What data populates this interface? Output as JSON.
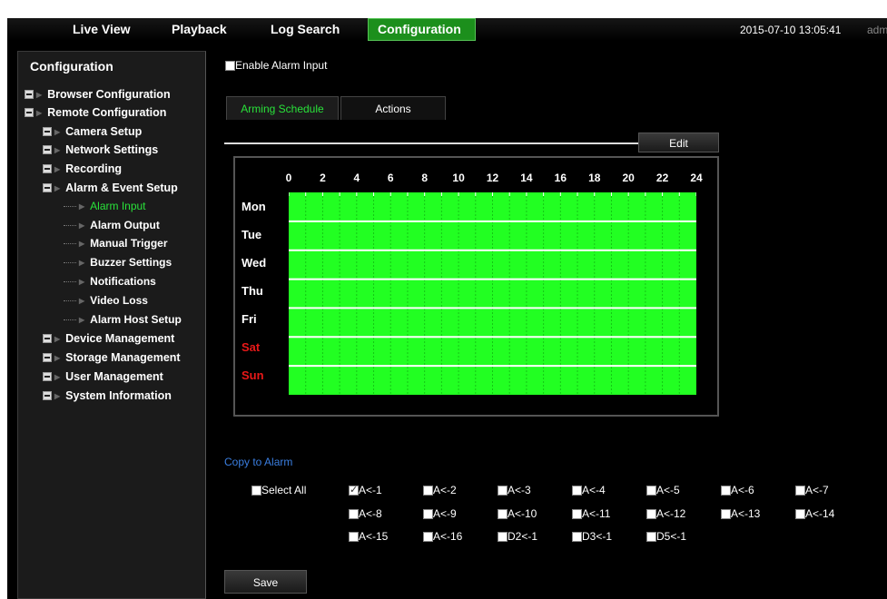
{
  "nav": {
    "tabs": [
      {
        "label": "Live View"
      },
      {
        "label": "Playback"
      },
      {
        "label": "Log Search"
      },
      {
        "label": "Configuration"
      }
    ],
    "datetime": "2015-07-10 13:05:41",
    "user": "adm"
  },
  "sidebar": {
    "title": "Configuration",
    "items": [
      {
        "label": "Browser Configuration"
      },
      {
        "label": "Remote Configuration"
      },
      {
        "label": "Camera Setup"
      },
      {
        "label": "Network Settings"
      },
      {
        "label": "Recording"
      },
      {
        "label": "Alarm & Event Setup"
      },
      {
        "label": "Alarm Input"
      },
      {
        "label": "Alarm Output"
      },
      {
        "label": "Manual Trigger"
      },
      {
        "label": "Buzzer Settings"
      },
      {
        "label": "Notifications"
      },
      {
        "label": "Video Loss"
      },
      {
        "label": "Alarm Host Setup"
      },
      {
        "label": "Device Management"
      },
      {
        "label": "Storage Management"
      },
      {
        "label": "User Management"
      },
      {
        "label": "System Information"
      }
    ]
  },
  "main": {
    "enable_label": "Enable Alarm Input",
    "tabs": [
      {
        "label": "Arming Schedule"
      },
      {
        "label": "Actions"
      }
    ],
    "edit_label": "Edit",
    "schedule": {
      "hours": [
        "0",
        "2",
        "4",
        "6",
        "8",
        "10",
        "12",
        "14",
        "16",
        "18",
        "20",
        "22",
        "24"
      ],
      "days": [
        "Mon",
        "Tue",
        "Wed",
        "Thu",
        "Fri",
        "Sat",
        "Sun"
      ],
      "armed_color": "#22ff22",
      "weekend_color": "#e81818"
    },
    "copy_title": "Copy to Alarm",
    "select_all": "Select All",
    "alarms": [
      "A<-1",
      "A<-2",
      "A<-3",
      "A<-4",
      "A<-5",
      "A<-6",
      "A<-7",
      "A<-8",
      "A<-9",
      "A<-10",
      "A<-11",
      "A<-12",
      "A<-13",
      "A<-14",
      "A<-15",
      "A<-16",
      "D2<-1",
      "D3<-1",
      "D5<-1"
    ],
    "save_label": "Save"
  }
}
